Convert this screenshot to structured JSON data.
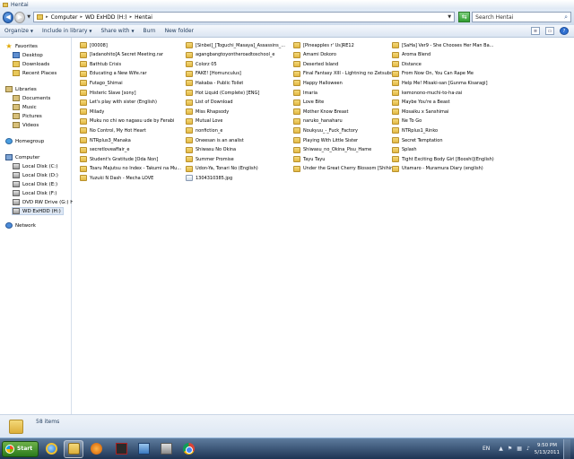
{
  "window": {
    "title": "Hentai"
  },
  "address": {
    "crumbs": [
      "Computer",
      "WD ExHDD (H:)",
      "Hentai"
    ],
    "search_placeholder": "Search Hentai"
  },
  "toolbar": {
    "organize": "Organize",
    "include_in_library": "Include in library",
    "share_with": "Share with",
    "burn": "Burn",
    "new_folder": "New folder"
  },
  "nav": {
    "favorites": "Favorites",
    "desktop": "Desktop",
    "downloads": "Downloads",
    "recent_places": "Recent Places",
    "libraries": "Libraries",
    "documents": "Documents",
    "music": "Music",
    "pictures": "Pictures",
    "videos": "Videos",
    "homegroup": "Homegroup",
    "computer": "Computer",
    "drives": [
      "Local Disk (C:)",
      "Local Disk (D:)",
      "Local Disk (E:)",
      "Local Disk (F:)",
      "DVD RW Drive (G:) HC",
      "WD ExHDD (H:)"
    ],
    "network": "Network"
  },
  "files": {
    "col1": [
      "[00008]",
      "[Iadanohito]A Secret Meeting.rar",
      "Bathtub Crisis",
      "Educating a New Wife.rar",
      "Futago_Shimai",
      "Histeric Slave [sony]",
      "Let's play with sister (English)",
      "Milady",
      "Muku no chi wo nagasu ude by Ferabi",
      "No Control, My Hot Heart",
      "NTRplus3_Manaka",
      "secretloveaffair_e",
      "Student's Gratitude [Oda Non]",
      "Toaru Majutsu no Index - Takumi na Mu...",
      "Yuzuki N Dash - Mecha LOVE"
    ],
    "col2": [
      "[Sinbei]_[Toguchi_Masaya]_Assassins_...",
      "agangbangtoyontheroadtoschool_e",
      "Colorz 05",
      "FAKE! [Homunculus]",
      "Hakaba - Public Toilet",
      "Hot Liquid (Complete) [ENG]",
      "List of Download",
      "Miss Rhapsody",
      "Mutual Love",
      "nonfiction_e",
      "Oneesan is an analist",
      "Shiwasu No Okina",
      "Summer Promise",
      "Udon-Ya, Tonari No (English)",
      "1304310385.jpg"
    ],
    "col3": [
      "[Pineapples r' Us]RE12",
      "Amami Dokoro",
      "Deserted Island",
      "Final Fantasy XIII - Lightning no Zetsubou",
      "Happy Halloween",
      "Imaria",
      "Love Bite",
      "Mother Know Breast",
      "naruko_hanaharu",
      "Noukyuu_-_Fuck_Factory",
      "Playing With Little Sister",
      "Shiwasu_no_Okina_Pisu_Hame",
      "Tayu Tayu",
      "Under the Great Cherry Blossom [Shihir..."
    ],
    "col4": [
      "[SaHa] Ver9 - She Chooses Her Man Ba...",
      "Aroma Blend",
      "Distance",
      "From Now On, You Can Rape Me",
      "Help Me! Misaki-san [Gunma Kisaragi]",
      "kemonono-muchi-to-ha-zai",
      "Maybe You're a Beast",
      "Mosaiku x Sanshimai",
      "Ne To Go",
      "NTRplus1_Rinko",
      "Secret Temptation",
      "Splash",
      "Tight Exciting Body Girl [Booshi](English)",
      "Utamaro - Muramura Diary (english)"
    ]
  },
  "details": {
    "count": "58 items"
  },
  "taskbar": {
    "start": "Start",
    "lang": "EN",
    "time": "9:50 PM",
    "date": "5/13/2011"
  },
  "icons": {
    "back": "back-arrow-icon",
    "forward": "forward-arrow-icon",
    "search": "magnifier-icon"
  }
}
